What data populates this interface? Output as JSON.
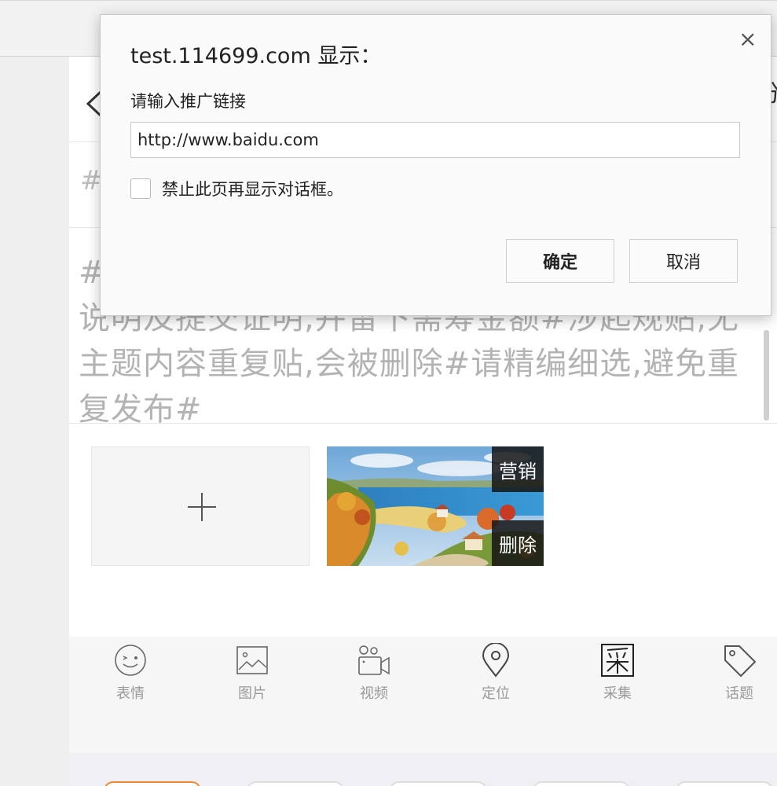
{
  "dialog": {
    "title": "test.114699.com 显示：",
    "prompt": "请输入推广链接",
    "input_value": "http://www.baidu.com",
    "checkbox_label": "禁止此页再显示对话框。",
    "ok_label": "确定",
    "cancel_label": "取消",
    "close_glyph": "×"
  },
  "page": {
    "header_right_char": "分",
    "title_placeholder": "#",
    "content_text": "#\n说明及提交证明,并留下需筹金额#涉起规贴,无主题内容重复贴,会被删除#请精编细选,避免重复发布#"
  },
  "image_tile": {
    "top_action": "营销",
    "bottom_action": "删除"
  },
  "toolbar": {
    "items": [
      {
        "label": "表情",
        "icon": "emoji-icon"
      },
      {
        "label": "图片",
        "icon": "image-icon"
      },
      {
        "label": "视频",
        "icon": "video-icon"
      },
      {
        "label": "定位",
        "icon": "location-icon"
      },
      {
        "label": "采集",
        "icon": "collect-icon"
      },
      {
        "label": "话题",
        "icon": "tag-icon"
      }
    ]
  },
  "colors": {
    "accent_pill": "#f08a30",
    "placeholder_text": "#b3b3b3",
    "toolbar_bg": "#f6f6f6"
  }
}
